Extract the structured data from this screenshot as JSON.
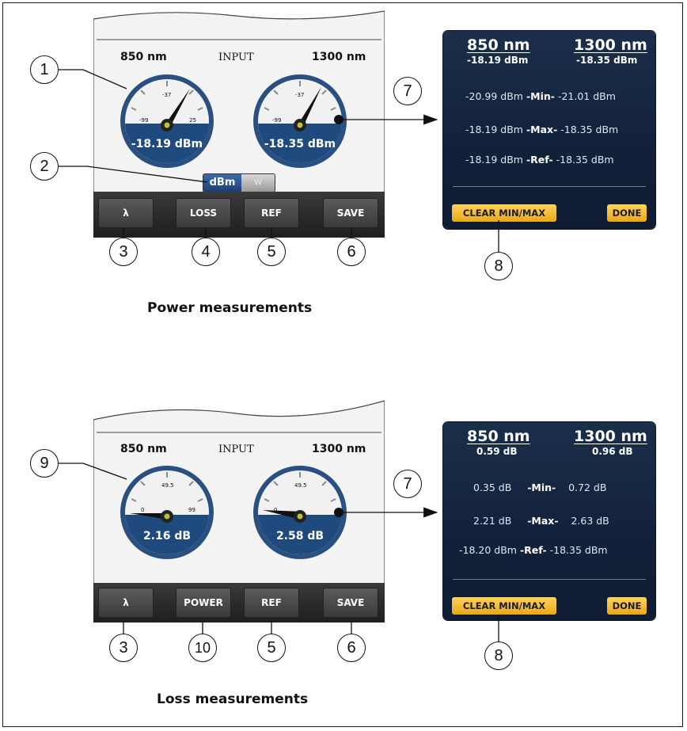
{
  "power_screen": {
    "left_wavelength": "850 nm",
    "center_label": "INPUT",
    "right_wavelength": "1300 nm",
    "gauge_left": {
      "ticks": [
        "-99",
        "-37",
        "25"
      ],
      "reading": "-18.19 dBm"
    },
    "gauge_right": {
      "ticks": [
        "-99",
        "-37"
      ],
      "reading": "-18.35 dBm"
    },
    "unit_toggle": {
      "selected": "dBm",
      "other": "W"
    },
    "buttons": [
      "λ",
      "LOSS",
      "REF",
      "SAVE"
    ]
  },
  "power_panel": {
    "col1_header": "850 nm",
    "col2_header": "1300 nm",
    "col1_value": "-18.19 dBm",
    "col2_value": "-18.35 dBm",
    "rows": [
      {
        "left": "-20.99 dBm",
        "label": "-Min-",
        "right": "-21.01 dBm"
      },
      {
        "left": "-18.19 dBm",
        "label": "-Max-",
        "right": "-18.35 dBm"
      },
      {
        "left": "-18.19 dBm",
        "label": "-Ref-",
        "right": "-18.35 dBm"
      }
    ],
    "clear_button": "CLEAR MIN/MAX",
    "done_button": "DONE"
  },
  "loss_screen": {
    "left_wavelength": "850 nm",
    "center_label": "INPUT",
    "right_wavelength": "1300 nm",
    "gauge_left": {
      "ticks": [
        "0",
        "49.5",
        "99"
      ],
      "reading": "2.16 dB"
    },
    "gauge_right": {
      "ticks": [
        "0",
        "49.5"
      ],
      "reading": "2.58 dB"
    },
    "buttons": [
      "λ",
      "POWER",
      "REF",
      "SAVE"
    ]
  },
  "loss_panel": {
    "col1_header": "850 nm",
    "col2_header": "1300 nm",
    "col1_value": "0.59 dB",
    "col2_value": "0.96 dB",
    "rows": [
      {
        "left": "0.35 dB",
        "label": "-Min-",
        "right": "0.72 dB"
      },
      {
        "left": "2.21 dB",
        "label": "-Max-",
        "right": "2.63 dB"
      },
      {
        "left": "-18.20 dBm",
        "label": "-Ref-",
        "right": "-18.35 dBm"
      }
    ],
    "clear_button": "CLEAR MIN/MAX",
    "done_button": "DONE"
  },
  "callouts": {
    "c1": "1",
    "c2": "2",
    "c3": "3",
    "c4": "4",
    "c5": "5",
    "c6": "6",
    "c7": "7",
    "c8": "8",
    "c9": "9",
    "c10": "10"
  },
  "captions": {
    "power": "Power measurements",
    "loss": "Loss measurements"
  }
}
